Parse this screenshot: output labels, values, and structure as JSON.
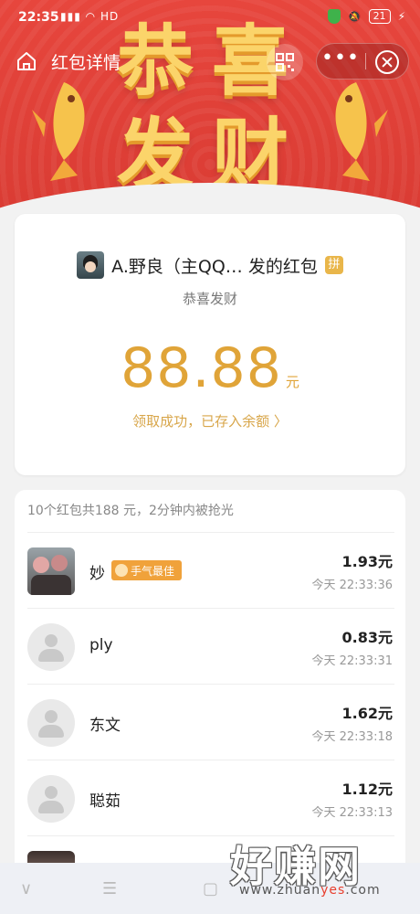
{
  "status_bar": {
    "time": "22:35",
    "network": "HD",
    "battery": "21"
  },
  "nav": {
    "title": "红包详情",
    "more_label": "•••"
  },
  "banner": {
    "chars": [
      "恭",
      "喜",
      "发",
      "财"
    ],
    "colors": {
      "background": "#e23f36",
      "text": "#fbd46a",
      "shadow": "#e49a2b"
    }
  },
  "packet": {
    "sender_text": "A.野良（主QQ… 发的红包",
    "pin_label": "拼",
    "greeting": "恭喜发财",
    "amount": "88.88",
    "unit": "元",
    "status": "领取成功，已存入余额 〉",
    "accent_color": "#e0a438"
  },
  "summary": {
    "text": "10个红包共188 元，2分钟内被抢光"
  },
  "recipients": [
    {
      "name": "妙",
      "badge": "手气最佳",
      "amount": "1.93元",
      "time": "今天 22:33:36",
      "avatar": "photo"
    },
    {
      "name": "ply",
      "badge": "",
      "amount": "0.83元",
      "time": "今天 22:33:31",
      "avatar": "default"
    },
    {
      "name": "东文",
      "badge": "",
      "amount": "1.62元",
      "time": "今天 22:33:18",
      "avatar": "default"
    },
    {
      "name": "聪茹",
      "badge": "",
      "amount": "1.12元",
      "time": "今天 22:33:13",
      "avatar": "default"
    }
  ],
  "system_bar": {
    "back": "∨",
    "menu": "☰",
    "home": "▢"
  },
  "watermark": {
    "big": "好赚网",
    "small_prefix": "www.zhuan",
    "small_accent": "yes",
    "small_suffix": ".com"
  }
}
